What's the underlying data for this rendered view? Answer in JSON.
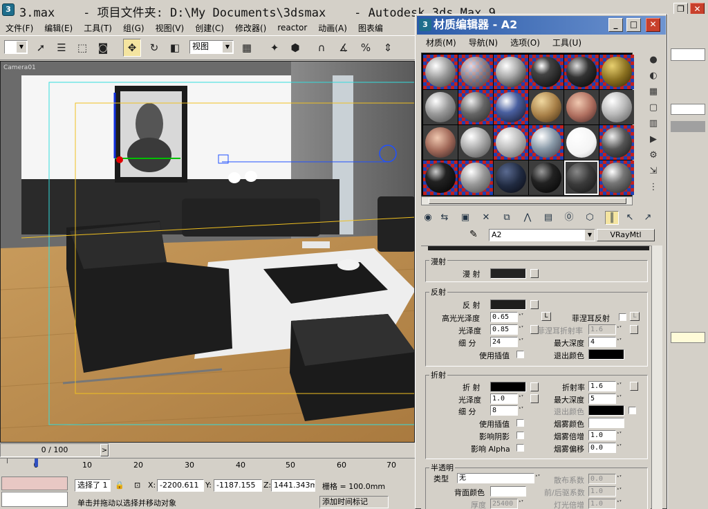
{
  "main_window": {
    "title": "3.max    - 项目文件夹: D:\\My Documents\\3dsmax    - Autodesk 3ds Max 9",
    "menu": [
      "文件(F)",
      "编辑(E)",
      "工具(T)",
      "组(G)",
      "视图(V)",
      "创建(C)",
      "修改器()",
      "reactor",
      "动画(A)",
      "图表编"
    ],
    "toolbar": {
      "view_combo": "视图"
    },
    "viewport_label": "Camera01",
    "time_slider": "0 / 100",
    "timeline_ticks": [
      "0",
      "10",
      "20",
      "30",
      "40",
      "50",
      "60",
      "70"
    ],
    "status": {
      "selected": "选择了 1",
      "x_label": "X:",
      "x_value": "-2200.611",
      "y_label": "Y:",
      "y_value": "-1187.155",
      "z_label": "Z:",
      "z_value": "1441.343m",
      "grid_label": "栅格 = 100.0mm",
      "prompt": "单击并拖动以选择并移动对象",
      "add_time_tag": "添加时间标记"
    }
  },
  "material_editor": {
    "title": "材质编辑器 - A2",
    "menu": [
      "材质(M)",
      "导航(N)",
      "选项(O)",
      "工具(U)"
    ],
    "material_name": "A2",
    "material_type": "VRayMtl",
    "diffuse": {
      "group": "漫射",
      "label": "漫 射"
    },
    "reflection": {
      "group": "反射",
      "label": "反 射",
      "hilight_gloss_label": "高光光泽度",
      "hilight_gloss": "0.65",
      "lock": "L",
      "fresnel_label": "菲涅耳反射",
      "fresnel_lock": "L",
      "gloss_label": "光泽度",
      "gloss": "0.85",
      "fresnel_ior_label": "菲涅耳折射率",
      "fresnel_ior": "1.6",
      "subdivs_label": "细 分",
      "subdivs": "24",
      "max_depth_label": "最大深度",
      "max_depth": "4",
      "interp_label": "使用插值",
      "exit_color_label": "退出颜色"
    },
    "refraction": {
      "group": "折射",
      "label": "折 射",
      "ior_label": "折射率",
      "ior": "1.6",
      "gloss_label": "光泽度",
      "gloss": "1.0",
      "max_depth_label": "最大深度",
      "max_depth": "5",
      "subdivs_label": "细 分",
      "subdivs": "8",
      "exit_color_label": "退出颜色",
      "interp_label": "使用插值",
      "fog_color_label": "烟雾颜色",
      "shadows_label": "影响阴影",
      "fog_mult_label": "烟雾倍增",
      "fog_mult": "1.0",
      "alpha_label": "影响 Alpha",
      "fog_bias_label": "烟雾偏移",
      "fog_bias": "0.0"
    },
    "translucency": {
      "group": "半透明",
      "type_label": "类型",
      "type": "无",
      "scatter_label": "散布系数",
      "scatter": "0.0",
      "back_color_label": "背面颜色",
      "fwd_back_label": "前/后驱系数",
      "fwd_back": "1.0",
      "thickness_label": "厚度",
      "thickness": "25400",
      "light_mult_label": "灯光倍增",
      "light_mult": "1.0"
    }
  },
  "colors": {
    "title_blue": "#2a5aa8",
    "active_tool": "#f4e4a0",
    "panel_bg": "#d4d0c8"
  }
}
